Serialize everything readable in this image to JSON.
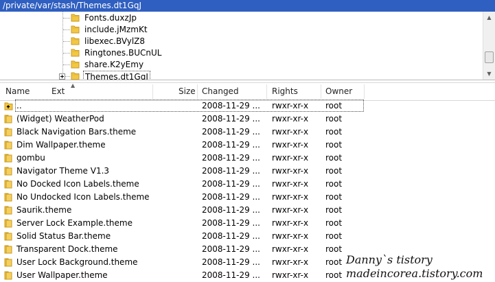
{
  "path_bar": {
    "path": "/private/var/stash/Themes.dt1GqJ"
  },
  "tree": {
    "items": [
      {
        "label": "Fonts.duxzJp",
        "selected": false,
        "expander": false
      },
      {
        "label": "include.jMzmKt",
        "selected": false,
        "expander": false
      },
      {
        "label": "libexec.BVylZ8",
        "selected": false,
        "expander": false
      },
      {
        "label": "Ringtones.BUCnUL",
        "selected": false,
        "expander": false
      },
      {
        "label": "share.K2yEmy",
        "selected": false,
        "expander": false
      },
      {
        "label": "Themes.dt1GqJ",
        "selected": true,
        "expander": true
      }
    ]
  },
  "columns": {
    "name": "Name",
    "ext": "Ext",
    "size": "Size",
    "changed": "Changed",
    "rights": "Rights",
    "owner": "Owner"
  },
  "files": [
    {
      "name": "..",
      "changed": "2008-11-29 ...",
      "rights": "rwxr-xr-x",
      "owner": "root",
      "icon": "parent-folder-icon"
    },
    {
      "name": "(Widget) WeatherPod",
      "changed": "2008-11-29 ...",
      "rights": "rwxr-xr-x",
      "owner": "root",
      "icon": "folder-icon"
    },
    {
      "name": "Black Navigation Bars.theme",
      "changed": "2008-11-29 ...",
      "rights": "rwxr-xr-x",
      "owner": "root",
      "icon": "folder-icon"
    },
    {
      "name": "Dim Wallpaper.theme",
      "changed": "2008-11-29 ...",
      "rights": "rwxr-xr-x",
      "owner": "root",
      "icon": "folder-icon"
    },
    {
      "name": "gombu",
      "changed": "2008-11-29 ...",
      "rights": "rwxr-xr-x",
      "owner": "root",
      "icon": "folder-icon"
    },
    {
      "name": "Navigator Theme V1.3",
      "changed": "2008-11-29 ...",
      "rights": "rwxr-xr-x",
      "owner": "root",
      "icon": "folder-icon"
    },
    {
      "name": "No Docked Icon Labels.theme",
      "changed": "2008-11-29 ...",
      "rights": "rwxr-xr-x",
      "owner": "root",
      "icon": "folder-icon"
    },
    {
      "name": "No Undocked Icon Labels.theme",
      "changed": "2008-11-29 ...",
      "rights": "rwxr-xr-x",
      "owner": "root",
      "icon": "folder-icon"
    },
    {
      "name": "Saurik.theme",
      "changed": "2008-11-29 ...",
      "rights": "rwxr-xr-x",
      "owner": "root",
      "icon": "folder-icon"
    },
    {
      "name": "Server Lock Example.theme",
      "changed": "2008-11-29 ...",
      "rights": "rwxr-xr-x",
      "owner": "root",
      "icon": "folder-icon"
    },
    {
      "name": "Solid Status Bar.theme",
      "changed": "2008-11-29 ...",
      "rights": "rwxr-xr-x",
      "owner": "root",
      "icon": "folder-icon"
    },
    {
      "name": "Transparent Dock.theme",
      "changed": "2008-11-29 ...",
      "rights": "rwxr-xr-x",
      "owner": "root",
      "icon": "folder-icon"
    },
    {
      "name": "User Lock Background.theme",
      "changed": "2008-11-29 ...",
      "rights": "rwxr-xr-x",
      "owner": "root",
      "icon": "folder-icon"
    },
    {
      "name": "User Wallpaper.theme",
      "changed": "2008-11-29 ...",
      "rights": "rwxr-xr-x",
      "owner": "root",
      "icon": "folder-icon"
    }
  ],
  "watermark": {
    "line1": "Danny`s tistory",
    "line2": "madeincorea.tistory.com"
  },
  "colors": {
    "path_bar_bg": "#2f5fc0",
    "folder_fill": "#f2c744",
    "folder_edge": "#c99a1e"
  }
}
